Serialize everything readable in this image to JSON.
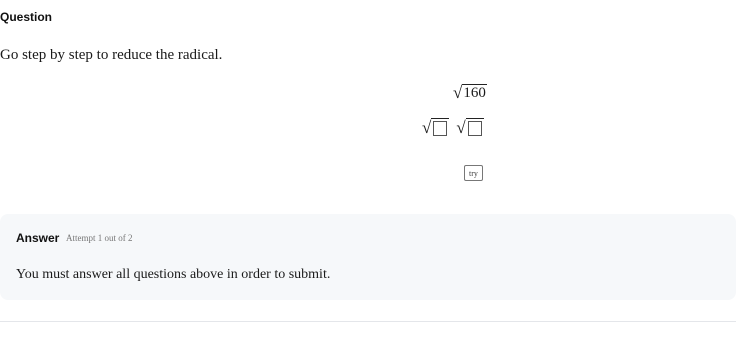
{
  "question": {
    "heading": "Question",
    "prompt": "Go step by step to reduce the radical.",
    "radicand": "160",
    "radical_symbol": "√",
    "try_button_label": "try"
  },
  "answer": {
    "title": "Answer",
    "attempt": "Attempt 1 out of 2",
    "message": "You must answer all questions above in order to submit."
  }
}
